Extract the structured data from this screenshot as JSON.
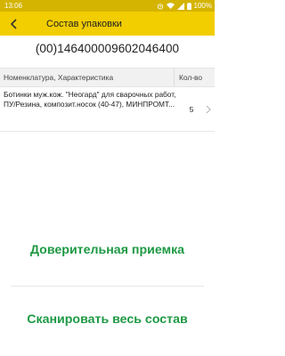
{
  "status_bar": {
    "time": "13:06",
    "battery": "100%"
  },
  "app_bar": {
    "title": "Состав упаковки",
    "back_icon": "chevron-left-icon"
  },
  "package_code": "(00)146400009602046400",
  "table": {
    "columns": [
      "Номенклатура, Характеристика",
      "Кол-во"
    ],
    "rows": [
      {
        "name": "Ботинки муж.кож. \"Неогард\" для сварочных работ, ПУ/Резина, композит.носок (40-47), МИНПРОМТ...",
        "qty": "5"
      }
    ]
  },
  "actions": {
    "trusted_accept": "Доверительная приемка",
    "scan_all": "Сканировать весь состав"
  },
  "colors": {
    "status_bar": "#d4b400",
    "app_bar": "#f2cd00",
    "action_text": "#1e9944"
  }
}
